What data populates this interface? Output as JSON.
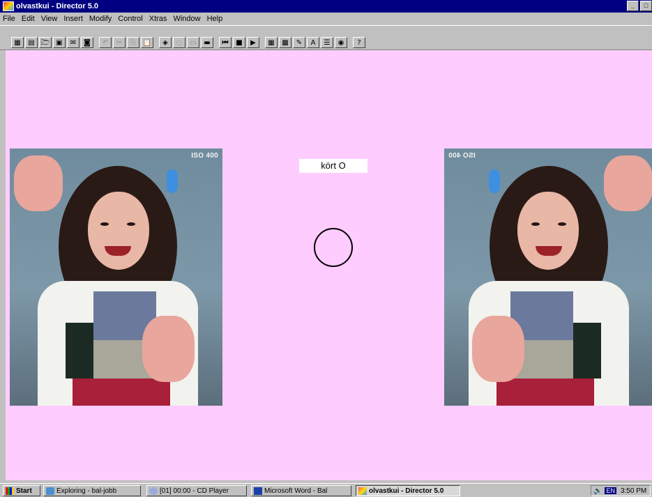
{
  "window": {
    "title": "olvastkui - Director 5.0",
    "controls": [
      "minimize",
      "maximize"
    ]
  },
  "menu": [
    "File",
    "Edit",
    "View",
    "Insert",
    "Modify",
    "Control",
    "Xtras",
    "Window",
    "Help"
  ],
  "stage": {
    "background": "#ffccff",
    "label": "kört O",
    "left_photo_stamp": "ISO 400",
    "right_photo_stamp": "ISO 400"
  },
  "taskbar": {
    "start": "Start",
    "tasks": [
      "Exploring - bal-jobb",
      "[01] 00:00 - CD Player",
      "Microsoft Word - Bal",
      "olvastkui - Director 5.0"
    ],
    "active_task": "olvastkui - Director 5.0",
    "lang": "EN",
    "clock": "3:50 PM"
  }
}
